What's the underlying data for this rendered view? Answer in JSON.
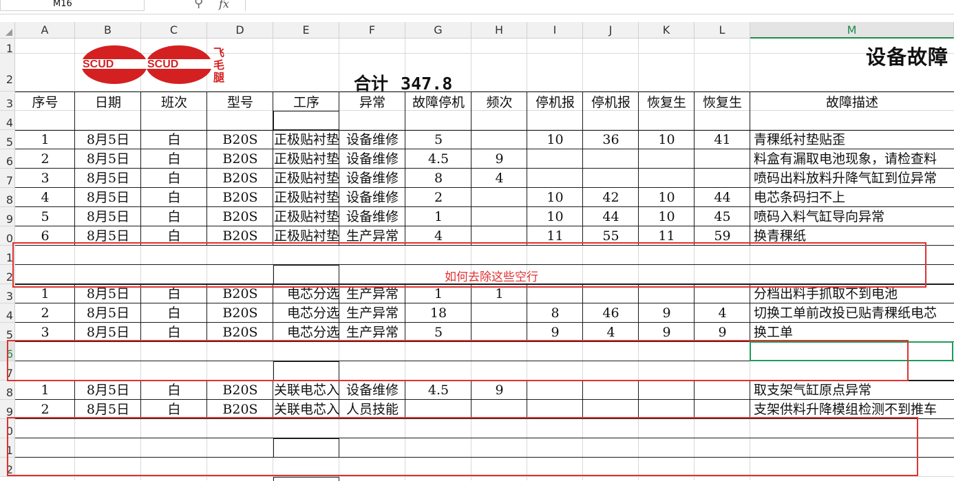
{
  "formula_bar": {
    "name_box": "M16",
    "fx_label": "fx",
    "zoom_icon": "magnifier-icon"
  },
  "columns": [
    "A",
    "B",
    "C",
    "D",
    "E",
    "F",
    "G",
    "H",
    "I",
    "J",
    "K",
    "L",
    "M"
  ],
  "active_column": "M",
  "row_numbers": [
    "1",
    "2",
    "3",
    "4",
    "5",
    "6",
    "7",
    "8",
    "9",
    "0",
    "1",
    "2",
    "3",
    "4",
    "5",
    "6",
    "7",
    "8",
    "9",
    "0",
    "1",
    "2"
  ],
  "active_row_index": 15,
  "sheet": {
    "title": "设备故障",
    "total_label": "合计",
    "total_value": "347.8",
    "logo_text": "SCUD飞毛腿"
  },
  "headers": [
    "序号",
    "日期",
    "班次",
    "型号",
    "工序",
    "异常",
    "故障停机",
    "频次",
    "停机报",
    "停机报",
    "恢复生",
    "恢复生",
    "故障描述"
  ],
  "rows": [
    {
      "row": 5,
      "cells": [
        "1",
        "8月5日",
        "白",
        "B20S",
        "正极贴衬垫",
        "设备维修",
        "5",
        "",
        "10",
        "36",
        "10",
        "41",
        "青稞纸衬垫贴歪"
      ]
    },
    {
      "row": 6,
      "cells": [
        "2",
        "8月5日",
        "白",
        "B20S",
        "正极贴衬垫",
        "设备维修",
        "4.5",
        "9",
        "",
        "",
        "",
        "",
        "料盒有漏取电池现象，请检查料"
      ]
    },
    {
      "row": 7,
      "cells": [
        "3",
        "8月5日",
        "白",
        "B20S",
        "正极贴衬垫",
        "设备维修",
        "8",
        "4",
        "",
        "",
        "",
        "",
        "喷码出料放料升降气缸到位异常"
      ]
    },
    {
      "row": 8,
      "cells": [
        "4",
        "8月5日",
        "白",
        "B20S",
        "正极贴衬垫",
        "设备维修",
        "2",
        "",
        "10",
        "42",
        "10",
        "44",
        "电芯条码扫不上"
      ]
    },
    {
      "row": 9,
      "cells": [
        "5",
        "8月5日",
        "白",
        "B20S",
        "正极贴衬垫",
        "设备维修",
        "1",
        "",
        "10",
        "44",
        "10",
        "45",
        "喷码入料气缸导向异常"
      ]
    },
    {
      "row": 10,
      "cells": [
        "6",
        "8月5日",
        "白",
        "B20S",
        "正极贴衬垫",
        "生产异常",
        "4",
        "",
        "11",
        "55",
        "11",
        "59",
        "换青稞纸"
      ]
    },
    {
      "row": 13,
      "cells": [
        "1",
        "8月5日",
        "白",
        "B20S",
        "电芯分选",
        "生产异常",
        "1",
        "1",
        "",
        "",
        "",
        "",
        "分档出料手抓取不到电池"
      ]
    },
    {
      "row": 14,
      "cells": [
        "2",
        "8月5日",
        "白",
        "B20S",
        "电芯分选",
        "生产异常",
        "18",
        "",
        "8",
        "46",
        "9",
        "4",
        "切换工单前改投已贴青稞纸电芯"
      ]
    },
    {
      "row": 15,
      "cells": [
        "3",
        "8月5日",
        "白",
        "B20S",
        "电芯分选",
        "生产异常",
        "5",
        "",
        "9",
        "4",
        "9",
        "9",
        "换工单"
      ]
    },
    {
      "row": 18,
      "cells": [
        "1",
        "8月5日",
        "白",
        "B20S",
        "关联电芯入",
        "设备维修",
        "4.5",
        "9",
        "",
        "",
        "",
        "",
        "取支架气缸原点异常"
      ]
    },
    {
      "row": 19,
      "cells": [
        "2",
        "8月5日",
        "白",
        "B20S",
        "关联电芯入",
        "人员技能",
        "",
        "",
        "",
        "",
        "",
        "",
        "支架供料升降模组检测不到推车"
      ]
    }
  ],
  "annotation": "如何去除这些空行",
  "colors": {
    "accent_green": "#1e8a4b",
    "annotation_red": "#e03030",
    "logo_red": "#d42020"
  }
}
